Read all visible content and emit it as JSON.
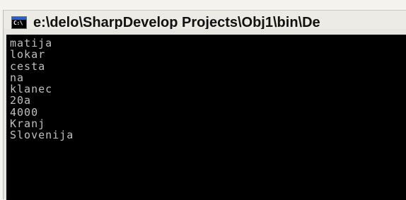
{
  "window": {
    "title": "e:\\delo\\SharpDevelop Projects\\Obj1\\bin\\De",
    "icon_text": "C:\\",
    "icon": "console-window-icon"
  },
  "console": {
    "lines": [
      "matija",
      "lokar",
      "cesta",
      "na",
      "klanec",
      "20a",
      "4000",
      "Kranj",
      "Slovenija"
    ]
  },
  "colors": {
    "console_bg": "#000000",
    "console_text": "#c0c0c0",
    "titlebar_bg": "#ecebe6"
  }
}
